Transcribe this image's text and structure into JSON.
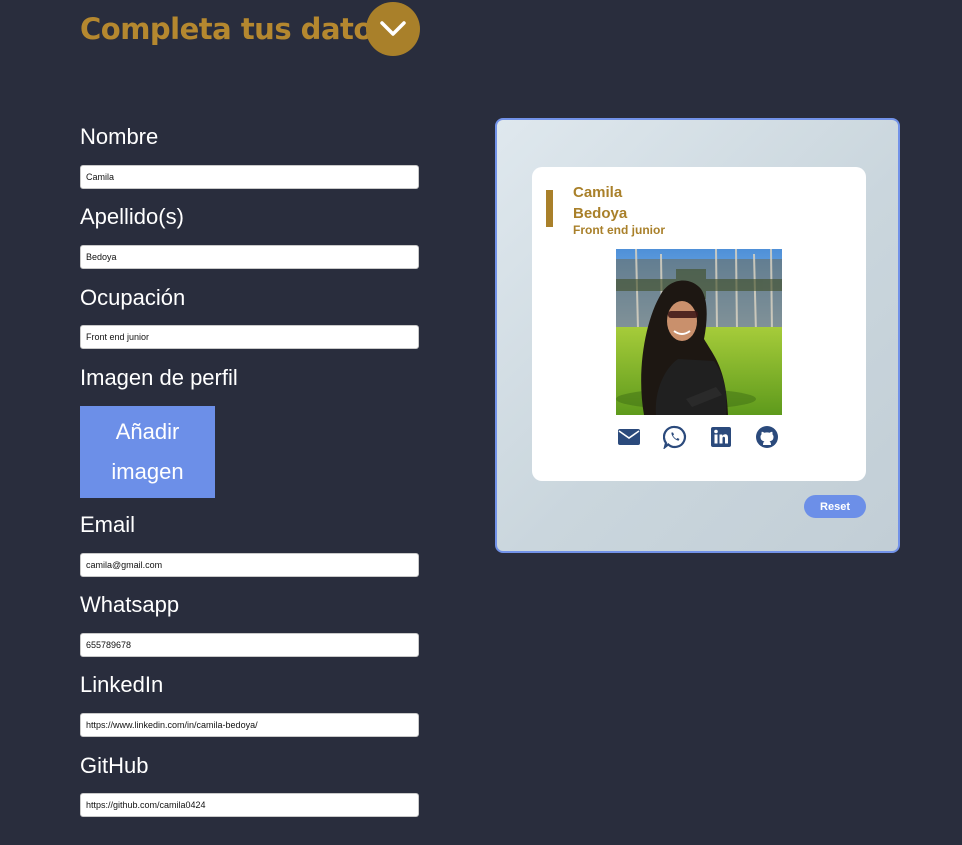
{
  "header": {
    "title": "Completa tus datos",
    "toggle_icon": "chevron-down-icon"
  },
  "form": {
    "name": {
      "label": "Nombre",
      "value": "Camila"
    },
    "lastname": {
      "label": "Apellido(s)",
      "value": "Bedoya"
    },
    "job": {
      "label": "Ocupación",
      "value": "Front end junior"
    },
    "image": {
      "label": "Imagen de perfil",
      "button_line1": "Añadir",
      "button_line2": "imagen"
    },
    "email": {
      "label": "Email",
      "value": "camila@gmail.com"
    },
    "phone": {
      "label": "Whatsapp",
      "value": "655789678"
    },
    "linkedin": {
      "label": "LinkedIn",
      "value": "https://www.linkedin.com/in/camila-bedoya/"
    },
    "github": {
      "label": "GitHub",
      "value": "https://github.com/camila0424"
    }
  },
  "preview": {
    "name": "Camila",
    "lastname": "Bedoya",
    "job": "Front end junior",
    "social_icons": [
      "envelope-icon",
      "whatsapp-icon",
      "linkedin-icon",
      "github-icon"
    ],
    "reset_label": "Reset"
  },
  "colors": {
    "background": "#292d3d",
    "accent_gold": "#a9802a",
    "accent_blue": "#6c8fe8",
    "icon_navy": "#2b4a7c"
  }
}
